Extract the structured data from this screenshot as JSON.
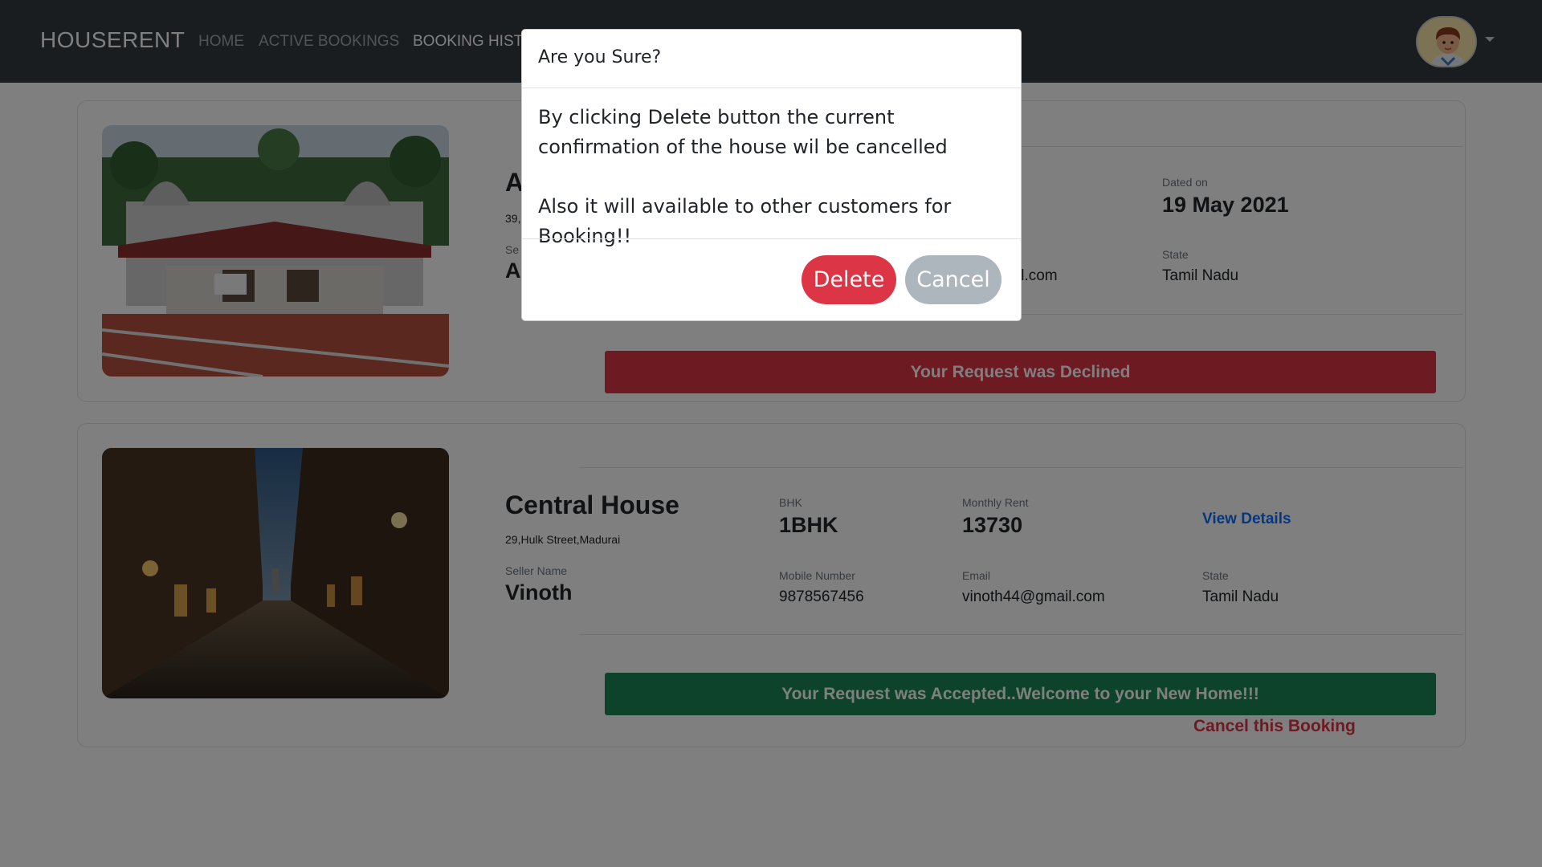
{
  "navbar": {
    "brand": "HOUSERENT",
    "links": [
      {
        "label": "HOME"
      },
      {
        "label": "ACTIVE BOOKINGS"
      },
      {
        "label": "BOOKING HIST"
      }
    ]
  },
  "bookings": [
    {
      "name_partial": "A",
      "address_partial": "39,",
      "seller_label_partial": "Se",
      "seller_partial": "A",
      "dated_label": "Dated on",
      "dated_value": "19 May 2021",
      "email_partial": "il.com",
      "state_label": "State",
      "state_value": "Tamil Nadu",
      "status": "Your Request was Declined"
    },
    {
      "name": "Central House",
      "address": "29,Hulk Street,Madurai",
      "bhk_label": "BHK",
      "bhk_value": "1BHK",
      "rent_label": "Monthly Rent",
      "rent_value": "13730",
      "view_details": "View Details",
      "seller_label": "Seller Name",
      "seller_value": "Vinoth",
      "mobile_label": "Mobile Number",
      "mobile_value": "9878567456",
      "email_label": "Email",
      "email_value": "vinoth44@gmail.com",
      "state_label": "State",
      "state_value": "Tamil Nadu",
      "status": "Your Request was Accepted..Welcome to your New Home!!!",
      "cancel_link": "Cancel this Booking"
    }
  ],
  "modal": {
    "title": "Are you Sure?",
    "body_line1": "By clicking Delete button the current confirmation of the house wil be cancelled",
    "body_line2": "Also it will available to other customers for Booking!!",
    "delete_label": "Delete",
    "cancel_label": "Cancel"
  },
  "colors": {
    "navbar": "#343a40",
    "danger": "#dc3545",
    "success": "#198754",
    "link": "#0d6efd",
    "secondary": "#adb5bd"
  }
}
